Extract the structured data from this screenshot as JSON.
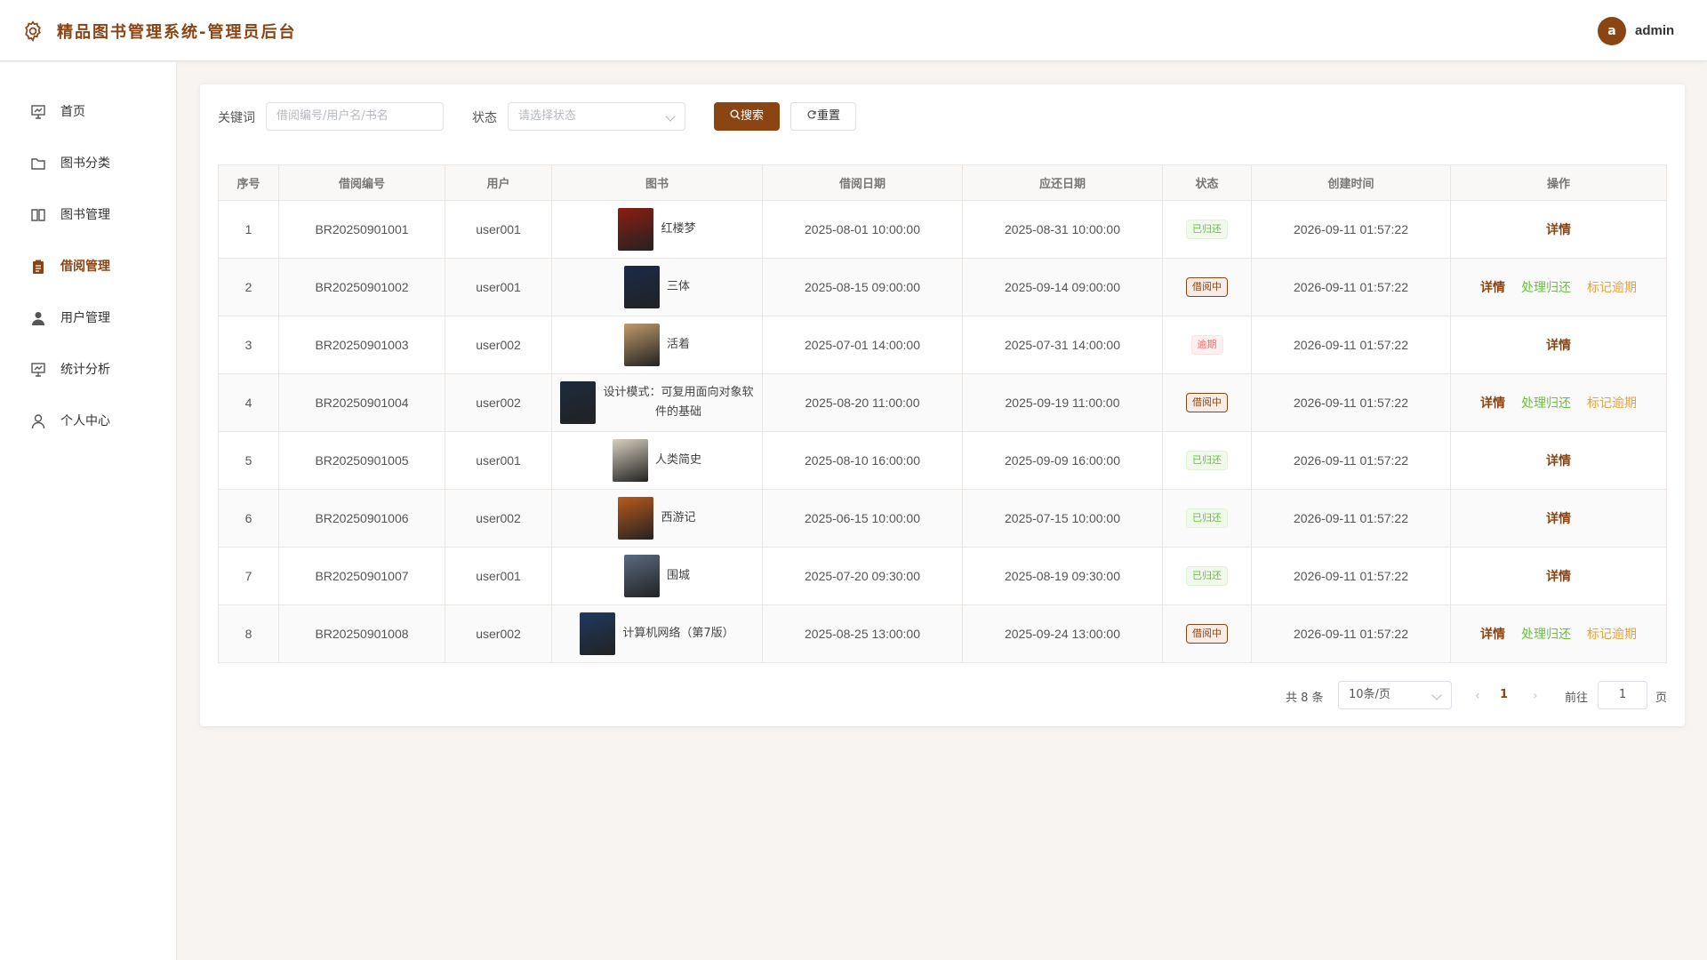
{
  "app": {
    "title": "精品图书管理系统-管理员后台"
  },
  "user": {
    "avatar_letter": "a",
    "name": "admin"
  },
  "sidebar": {
    "items": [
      {
        "label": "首页",
        "icon": "dashboard-icon",
        "active": false
      },
      {
        "label": "图书分类",
        "icon": "folder-icon",
        "active": false
      },
      {
        "label": "图书管理",
        "icon": "book-icon",
        "active": false
      },
      {
        "label": "借阅管理",
        "icon": "clipboard-icon",
        "active": true
      },
      {
        "label": "用户管理",
        "icon": "user-filled-icon",
        "active": false
      },
      {
        "label": "统计分析",
        "icon": "chart-icon",
        "active": false
      },
      {
        "label": "个人中心",
        "icon": "user-icon",
        "active": false
      }
    ]
  },
  "filters": {
    "keyword_label": "关键词",
    "keyword_placeholder": "借阅编号/用户名/书名",
    "status_label": "状态",
    "status_placeholder": "请选择状态",
    "search_button": "搜索",
    "reset_button": "重置"
  },
  "table": {
    "columns": [
      "序号",
      "借阅编号",
      "用户",
      "图书",
      "借阅日期",
      "应还日期",
      "状态",
      "创建时间",
      "操作"
    ],
    "rows": [
      {
        "no": "1",
        "code": "BR20250901001",
        "user": "user001",
        "book": "红楼梦",
        "cover_color": "#8b1e12",
        "borrow_date": "2025-08-01 10:00:00",
        "due_date": "2025-08-31 10:00:00",
        "status": "已归还",
        "status_type": "returned",
        "created": "2026-09-11 01:57:22",
        "actions": [
          "详情"
        ]
      },
      {
        "no": "2",
        "code": "BR20250901002",
        "user": "user001",
        "book": "三体",
        "cover_color": "#1a2a4a",
        "borrow_date": "2025-08-15 09:00:00",
        "due_date": "2025-09-14 09:00:00",
        "status": "借阅中",
        "status_type": "borrowing",
        "created": "2026-09-11 01:57:22",
        "actions": [
          "详情",
          "处理归还",
          "标记逾期"
        ]
      },
      {
        "no": "3",
        "code": "BR20250901003",
        "user": "user002",
        "book": "活着",
        "cover_color": "#c09a6a",
        "borrow_date": "2025-07-01 14:00:00",
        "due_date": "2025-07-31 14:00:00",
        "status": "逾期",
        "status_type": "overdue",
        "created": "2026-09-11 01:57:22",
        "actions": [
          "详情"
        ]
      },
      {
        "no": "4",
        "code": "BR20250901004",
        "user": "user002",
        "book": "设计模式：可复用面向对象软件的基础",
        "cover_color": "#1c2a3f",
        "borrow_date": "2025-08-20 11:00:00",
        "due_date": "2025-09-19 11:00:00",
        "status": "借阅中",
        "status_type": "borrowing",
        "created": "2026-09-11 01:57:22",
        "actions": [
          "详情",
          "处理归还",
          "标记逾期"
        ]
      },
      {
        "no": "5",
        "code": "BR20250901005",
        "user": "user001",
        "book": "人类简史",
        "cover_color": "#d8d0c0",
        "borrow_date": "2025-08-10 16:00:00",
        "due_date": "2025-09-09 16:00:00",
        "status": "已归还",
        "status_type": "returned",
        "created": "2026-09-11 01:57:22",
        "actions": [
          "详情"
        ]
      },
      {
        "no": "6",
        "code": "BR20250901006",
        "user": "user002",
        "book": "西游记",
        "cover_color": "#b85a1a",
        "borrow_date": "2025-06-15 10:00:00",
        "due_date": "2025-07-15 10:00:00",
        "status": "已归还",
        "status_type": "returned",
        "created": "2026-09-11 01:57:22",
        "actions": [
          "详情"
        ]
      },
      {
        "no": "7",
        "code": "BR20250901007",
        "user": "user001",
        "book": "围城",
        "cover_color": "#5a6a80",
        "borrow_date": "2025-07-20 09:30:00",
        "due_date": "2025-08-19 09:30:00",
        "status": "已归还",
        "status_type": "returned",
        "created": "2026-09-11 01:57:22",
        "actions": [
          "详情"
        ]
      },
      {
        "no": "8",
        "code": "BR20250901008",
        "user": "user002",
        "book": "计算机网络（第7版）",
        "cover_color": "#1e3a5f",
        "borrow_date": "2025-08-25 13:00:00",
        "due_date": "2025-09-24 13:00:00",
        "status": "借阅中",
        "status_type": "borrowing",
        "created": "2026-09-11 01:57:22",
        "actions": [
          "详情",
          "处理归还",
          "标记逾期"
        ]
      }
    ]
  },
  "pagination": {
    "total_text": "共 8 条",
    "page_size": "10条/页",
    "current_page": "1",
    "goto_label": "前往",
    "goto_value": "1",
    "page_unit": "页"
  },
  "colors": {
    "accent": "#8b4513",
    "success": "#67c23a",
    "warning": "#e6a23c",
    "danger": "#f56c6c"
  }
}
